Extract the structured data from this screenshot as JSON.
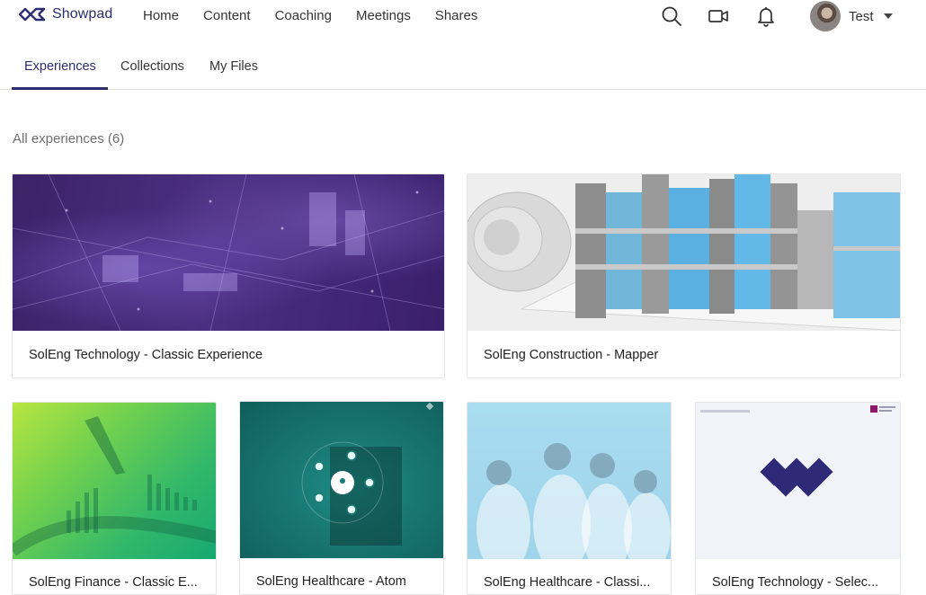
{
  "brand": {
    "name": "Showpad",
    "color": "#2b2d6e"
  },
  "nav": {
    "items": [
      "Home",
      "Content",
      "Coaching",
      "Meetings",
      "Shares"
    ]
  },
  "header_icons": [
    "search-icon",
    "video-camera-icon",
    "bell-icon"
  ],
  "user": {
    "name": "Test"
  },
  "tabs": [
    "Experiences",
    "Collections",
    "My Files"
  ],
  "active_tab": "Experiences",
  "section": {
    "title": "All experiences (6)"
  },
  "cards": [
    {
      "label": "SolEng Technology - Classic Experience"
    },
    {
      "label": "SolEng Construction - Mapper"
    },
    {
      "label": "SolEng Finance - Classic E..."
    },
    {
      "label": "SolEng Healthcare - Atom"
    },
    {
      "label": "SolEng Healthcare - Classi..."
    },
    {
      "label": "SolEng Technology - Selec..."
    }
  ]
}
